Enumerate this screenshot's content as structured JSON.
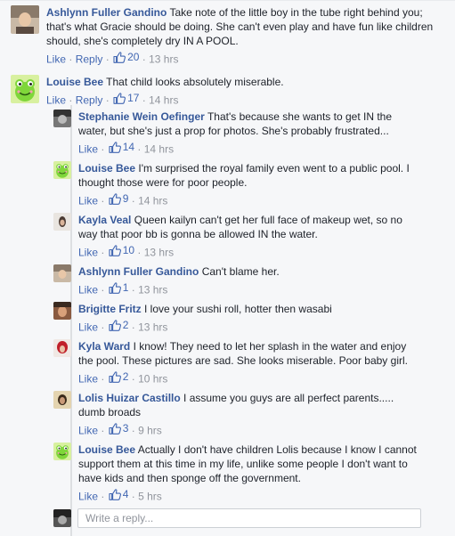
{
  "comments": [
    {
      "author": "Ashlynn Fuller Gandino",
      "text": "Take note of the little boy in the tube right behind you; that's what Gracie should be doing. She can't even play and have fun like children should, she's completely dry IN A POOL.",
      "like": "Like",
      "reply": "Reply",
      "likes": "20",
      "time": "13 hrs"
    },
    {
      "author": "Louise Bee",
      "text": "That child looks absolutely miserable.",
      "like": "Like",
      "reply": "Reply",
      "likes": "17",
      "time": "14 hrs"
    }
  ],
  "replies": [
    {
      "author": "Stephanie Wein Oefinger",
      "text": "That's because she wants to get IN the water, but she's just a prop for photos. She's probably frustrated...",
      "like": "Like",
      "likes": "14",
      "time": "14 hrs"
    },
    {
      "author": "Louise Bee",
      "text": "I'm surprised the royal family even went to a public pool. I thought those were for poor people.",
      "like": "Like",
      "likes": "9",
      "time": "14 hrs"
    },
    {
      "author": "Kayla Veal",
      "text": "Queen kailyn can't get her full face of makeup wet, so no way that poor bb is gonna be allowed IN the water.",
      "like": "Like",
      "likes": "10",
      "time": "13 hrs"
    },
    {
      "author": "Ashlynn Fuller Gandino",
      "text": "Can't blame her.",
      "like": "Like",
      "likes": "1",
      "time": "13 hrs"
    },
    {
      "author": "Brigitte Fritz",
      "text": "I love your sushi roll, hotter then wasabi",
      "like": "Like",
      "likes": "2",
      "time": "13 hrs"
    },
    {
      "author": "Kyla Ward",
      "text": "I know! They need to let her splash in the water and enjoy the pool. These pictures are sad. She looks miserable. Poor baby girl.",
      "like": "Like",
      "likes": "2",
      "time": "10 hrs"
    },
    {
      "author": "Lolis Huizar Castillo",
      "text": "I assume you guys are all perfect parents..... dumb broads",
      "like": "Like",
      "likes": "3",
      "time": "9 hrs"
    },
    {
      "author": "Louise Bee",
      "text": "Actually I don't have children Lolis because I know I cannot support them at this time in my life, unlike some people I don't want to have kids and then sponge off the government.",
      "like": "Like",
      "likes": "4",
      "time": "5 hrs"
    }
  ],
  "reply_input": {
    "placeholder": "Write a reply..."
  },
  "colors": {
    "link": "#365899",
    "action": "#4267b2",
    "muted": "#90949c",
    "background": "#f6f7f9"
  }
}
